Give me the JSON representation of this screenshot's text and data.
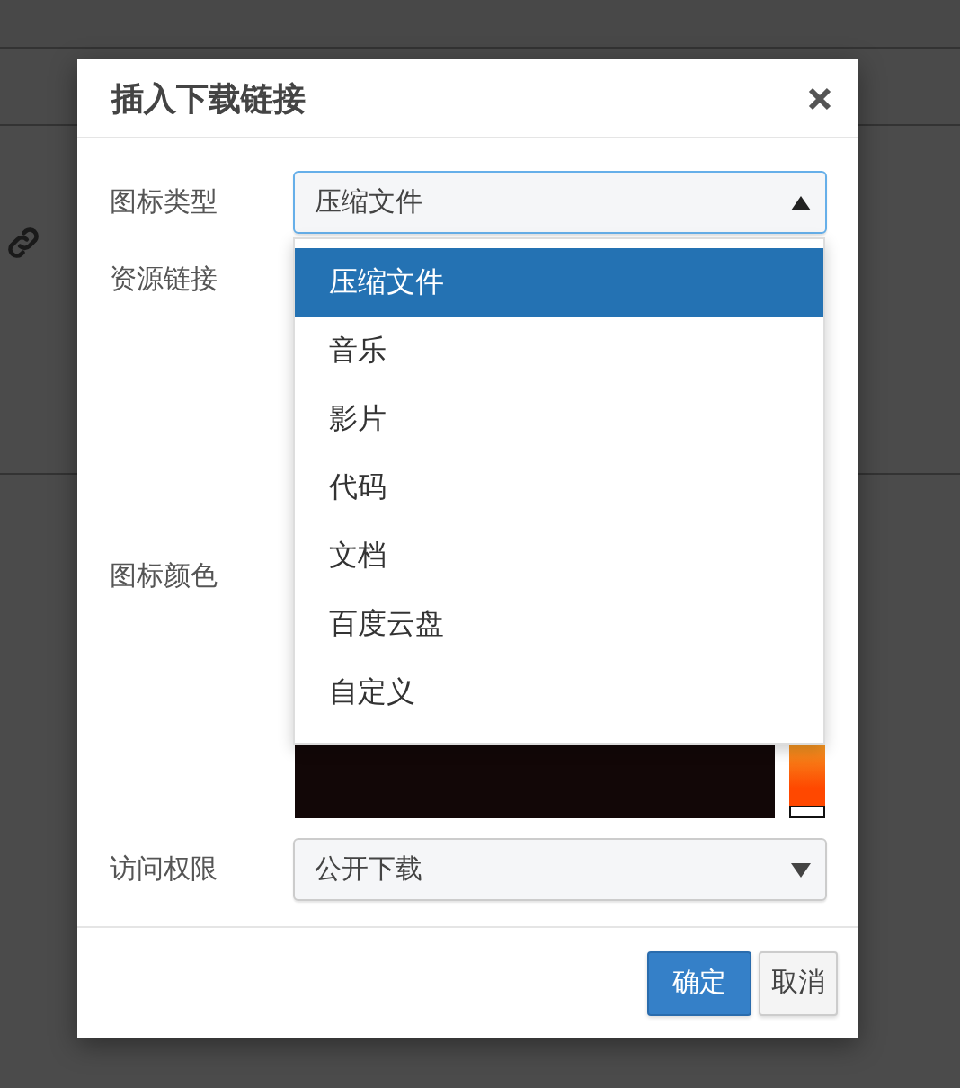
{
  "dialog": {
    "title": "插入下载链接",
    "fields": [
      {
        "kind": "select",
        "label": "图标类型",
        "value": "压缩文件",
        "expanded": true,
        "options": [
          {
            "label": "压缩文件",
            "selected": true
          },
          {
            "label": "音乐",
            "selected": false
          },
          {
            "label": "影片",
            "selected": false
          },
          {
            "label": "代码",
            "selected": false
          },
          {
            "label": "文档",
            "selected": false
          },
          {
            "label": "百度云盘",
            "selected": false
          },
          {
            "label": "自定义",
            "selected": false
          }
        ]
      },
      {
        "kind": "link",
        "label": "资源链接"
      },
      {
        "kind": "color",
        "label": "图标颜色",
        "level": 0
      },
      {
        "kind": "select",
        "label": "访问权限",
        "value": "公开下载",
        "expanded": false
      }
    ],
    "buttons": [
      {
        "label": "确定",
        "kind": "primary"
      },
      {
        "label": "取消",
        "kind": "default"
      }
    ]
  }
}
